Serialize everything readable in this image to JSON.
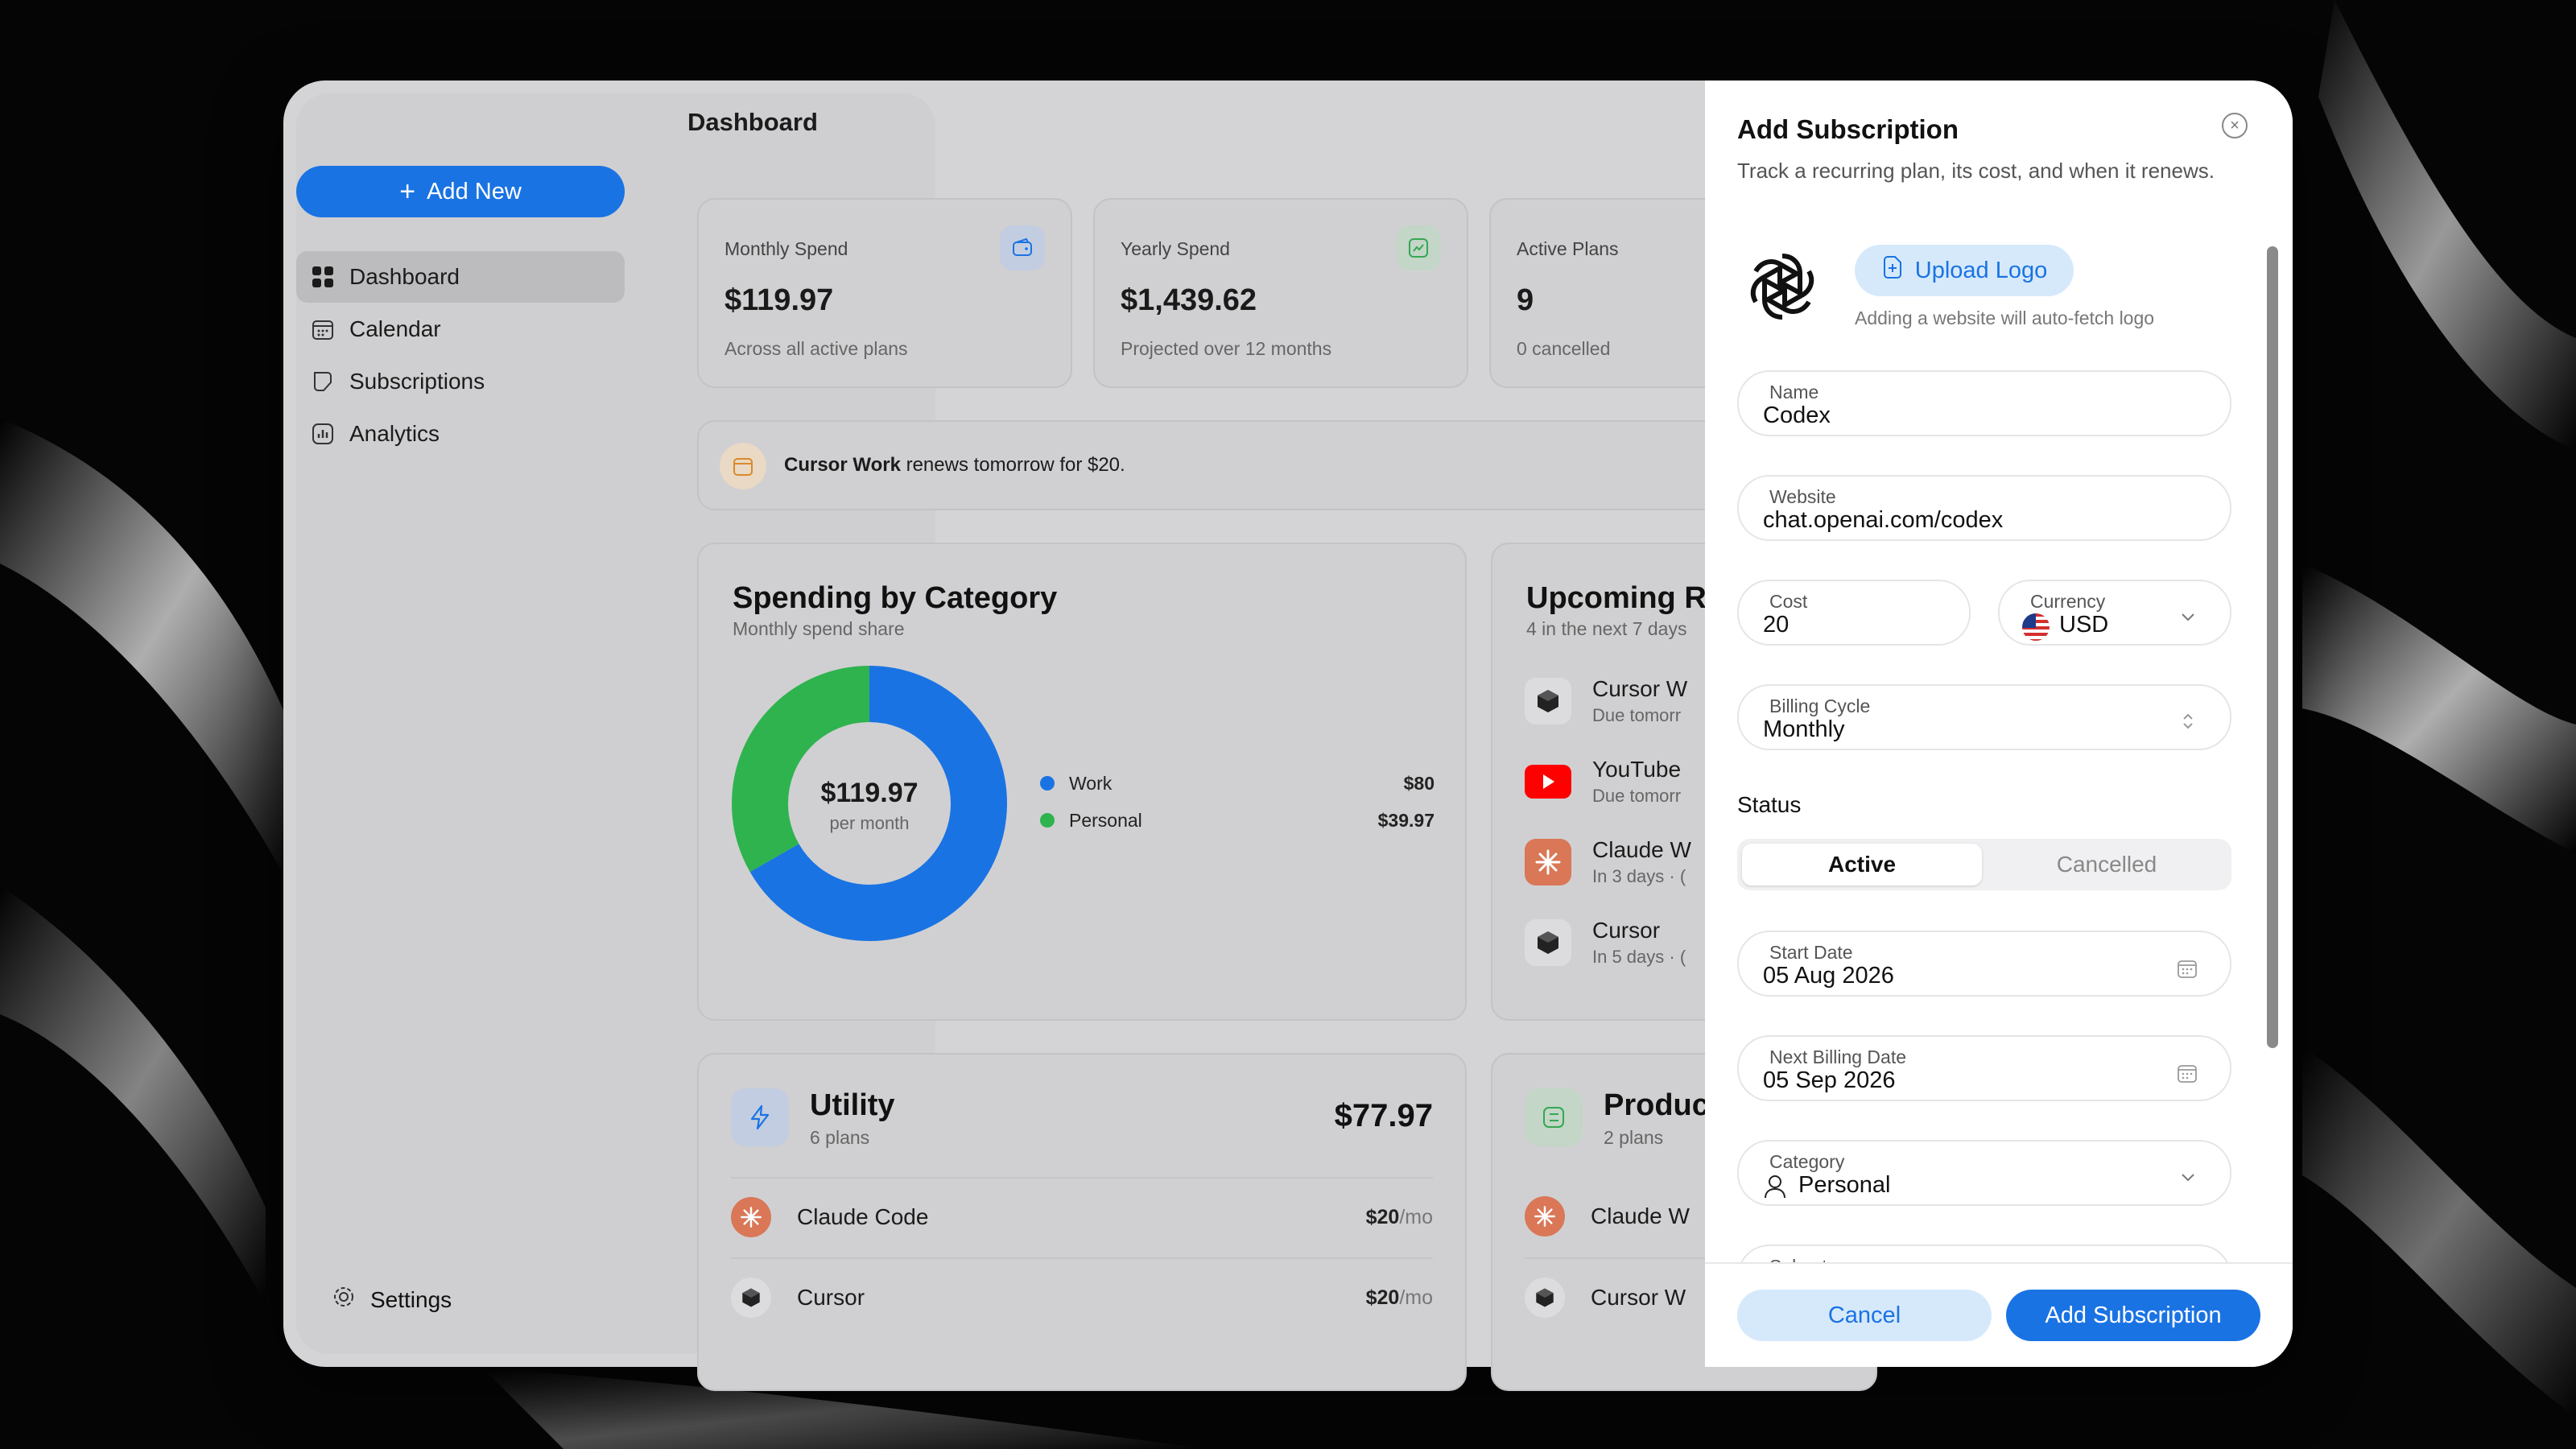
{
  "sidebar": {
    "add_new_label": "Add New",
    "items": [
      {
        "label": "Dashboard",
        "icon": "grid-icon"
      },
      {
        "label": "Calendar",
        "icon": "calendar-icon"
      },
      {
        "label": "Subscriptions",
        "icon": "subscriptions-icon"
      },
      {
        "label": "Analytics",
        "icon": "analytics-icon"
      }
    ],
    "settings_label": "Settings"
  },
  "main": {
    "title": "Dashboard",
    "stats": [
      {
        "label": "Monthly Spend",
        "value": "$119.97",
        "sub": "Across all active plans",
        "icon": "wallet-icon",
        "accent": "#1a73e3"
      },
      {
        "label": "Yearly Spend",
        "value": "$1,439.62",
        "sub": "Projected over 12 months",
        "icon": "trend-icon",
        "accent": "#34a853"
      },
      {
        "label": "Active Plans",
        "value": "9",
        "sub": "0 cancelled"
      }
    ],
    "alert": {
      "bold": "Cursor Work",
      "text": " renews tomorrow for $20."
    },
    "spending": {
      "title": "Spending by Category",
      "subtitle": "Monthly spend share",
      "center_value": "$119.97",
      "center_sub": "per month",
      "legend": [
        {
          "label": "Work",
          "value": "$80",
          "color": "#1a73e3"
        },
        {
          "label": "Personal",
          "value": "$39.97",
          "color": "#2fb34f"
        }
      ]
    },
    "upcoming": {
      "title": "Upcoming Re",
      "subtitle": "4 in the next 7 days",
      "items": [
        {
          "name": "Cursor W",
          "sub": "Due tomorr"
        },
        {
          "name": "YouTube",
          "sub": "Due tomorr"
        },
        {
          "name": "Claude W",
          "sub": "In 3 days · ("
        },
        {
          "name": "Cursor",
          "sub": "In 5 days · ("
        }
      ]
    },
    "utility": {
      "title": "Utility",
      "subtitle": "6 plans",
      "total": "$77.97",
      "items": [
        {
          "name": "Claude Code",
          "price": "$20",
          "unit": "/mo"
        },
        {
          "name": "Cursor",
          "price": "$20",
          "unit": "/mo"
        }
      ]
    },
    "productivity": {
      "title": "Produc",
      "subtitle": "2 plans",
      "items": [
        {
          "name": "Claude W"
        },
        {
          "name": "Cursor W"
        }
      ]
    }
  },
  "panel": {
    "title": "Add Subscription",
    "description": "Track a recurring plan, its cost, and when it renews.",
    "upload_label": "Upload Logo",
    "upload_hint": "Adding a website will auto-fetch logo",
    "name_label": "Name",
    "name_value": "Codex",
    "website_label": "Website",
    "website_value": "chat.openai.com/codex",
    "cost_label": "Cost",
    "cost_value": "20",
    "currency_label": "Currency",
    "currency_value": "USD",
    "billing_label": "Billing Cycle",
    "billing_value": "Monthly",
    "status_label": "Status",
    "status_options": [
      "Active",
      "Cancelled"
    ],
    "start_label": "Start Date",
    "start_value": "05 Aug 2026",
    "next_label": "Next Billing Date",
    "next_value": "05 Sep 2026",
    "category_label": "Category",
    "category_value": "Personal",
    "subcategory_label": "Subcategory",
    "cancel_label": "Cancel",
    "submit_label": "Add Subscription"
  }
}
